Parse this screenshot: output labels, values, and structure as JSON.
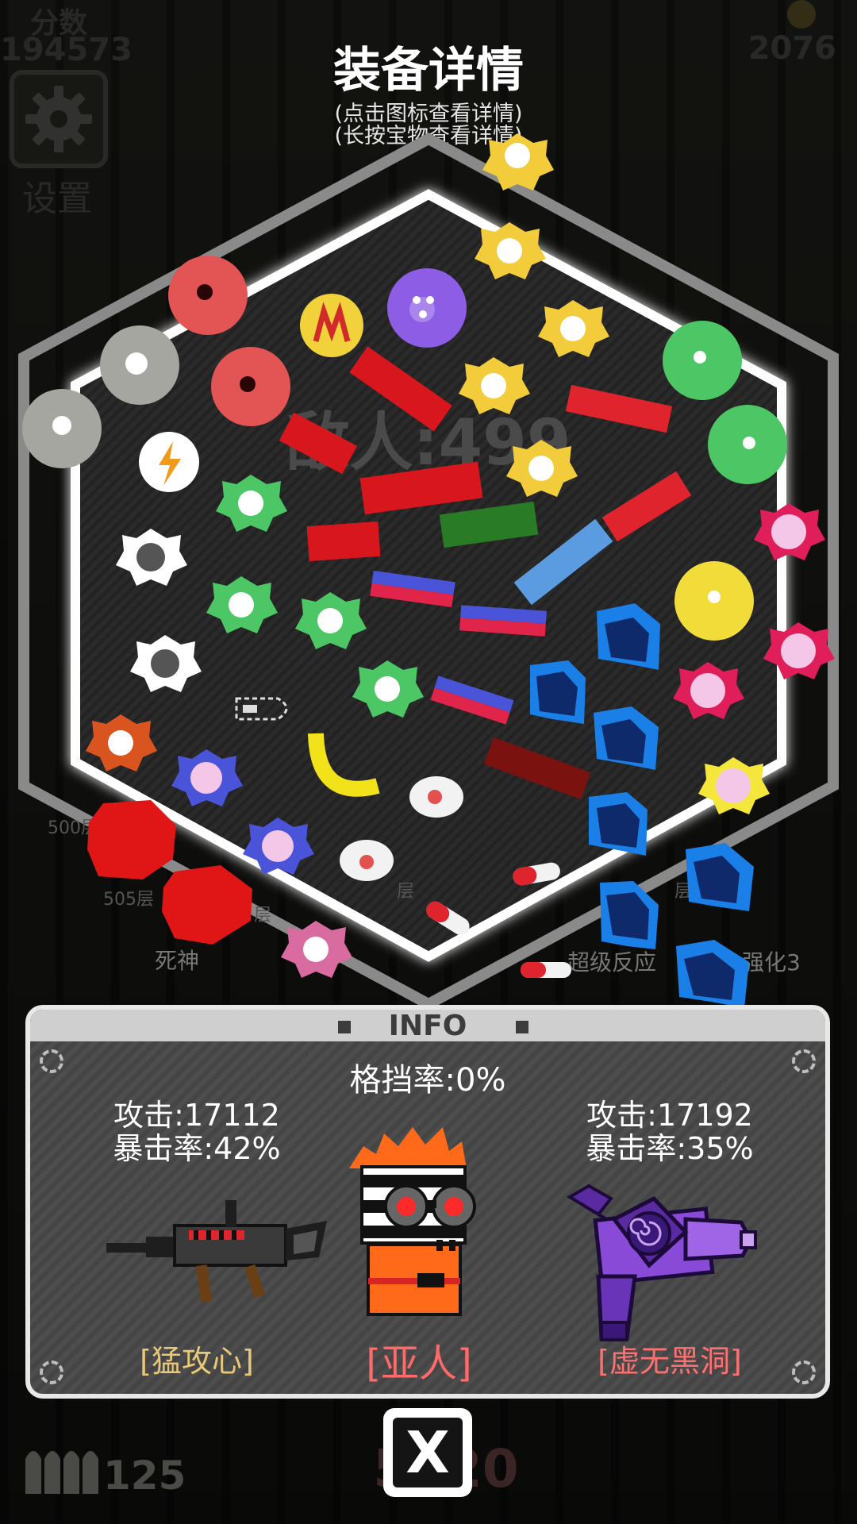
{
  "hud": {
    "score_label": "分数",
    "score_value": "194573",
    "coins_value": "2076",
    "settings_label": "设置",
    "ammo_count": "125",
    "bottom_number": "5020"
  },
  "overlay": {
    "title": "装备详情",
    "hint_line1": "(点击图标查看详情)",
    "hint_line2": "(长按宝物查看详情)"
  },
  "board": {
    "center_text": "敌人:499",
    "floor_labels": [
      "500层",
      "505层",
      "层",
      "层",
      "层"
    ],
    "skill_labels": [
      "死神",
      "超级反应",
      "强化3"
    ]
  },
  "info": {
    "header": "INFO",
    "block_rate": "格挡率:0%",
    "left_weapon": {
      "attack": "攻击:17112",
      "crit": "暴击率:42%",
      "name": "[猛攻心]",
      "name_color": "#e8c97a"
    },
    "character": {
      "name": "[亚人]",
      "name_color": "#ff7070"
    },
    "right_weapon": {
      "attack": "攻击:17192",
      "crit": "暴击率:35%",
      "name": "[虚无黑洞]",
      "name_color": "#ff7070"
    }
  },
  "close_button": {
    "label": "X"
  }
}
